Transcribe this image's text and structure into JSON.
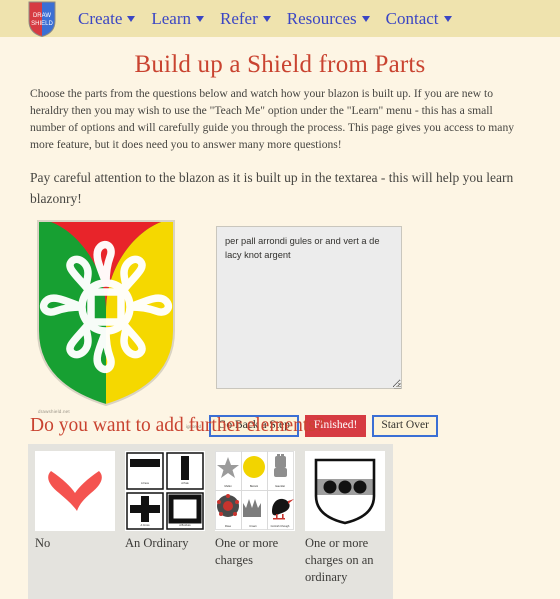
{
  "nav": {
    "logo": {
      "name": "drawshield-logo",
      "line1": "DRAW",
      "line2": "SHIELD",
      "left_color": "#d63b42",
      "right_color": "#3b6fd4"
    },
    "items": [
      {
        "label": "Create",
        "icon": "chevron-down-icon"
      },
      {
        "label": "Learn",
        "icon": "chevron-down-icon"
      },
      {
        "label": "Refer",
        "icon": "chevron-down-icon"
      },
      {
        "label": "Resources",
        "icon": "chevron-down-icon"
      },
      {
        "label": "Contact",
        "icon": "chevron-down-icon"
      }
    ],
    "link_color": "#3b46c4",
    "bar_color": "#efe3ae"
  },
  "page": {
    "title": "Build up a Shield from Parts",
    "title_color": "#c94330",
    "background_color": "#fdf5e4",
    "paragraph1": "Choose the parts from the questions below and watch how your blazon is built up. If you are new to heraldry then you may wish to use the \"Teach Me\" option under the \"Learn\" menu - this has a small number of options and will carefully guide you through the process. This page gives you access to many more feature, but it does need you to answer many more questions!",
    "paragraph2": "Pay careful attention to the blazon as it is built up in the textarea - this will help you learn blazonry!"
  },
  "shield_preview": {
    "name": "shield-preview",
    "watermark": "drawshield.net",
    "division": "per pall arrondi",
    "field_colors": {
      "dexter": "#17a032",
      "chief": "#e8242a",
      "sinister": "#f5d800"
    },
    "charge": "de lacy knot",
    "charge_color": "#f2f2f2"
  },
  "blazon": {
    "name": "blazon-textarea",
    "value": "per pall arrondi  gules or and vert   a de lacy knot  argent",
    "placeholder": ""
  },
  "buttons": {
    "tiny_label": "ignored",
    "items": [
      {
        "label": "Go Back a Step",
        "style": "normal"
      },
      {
        "label": "Finished!",
        "style": "danger"
      },
      {
        "label": "Start Over",
        "style": "normal"
      }
    ],
    "border_color": "#3b6fd4",
    "danger_color": "#d63b42"
  },
  "question": {
    "heading": "Do you want to add further elements?",
    "options": [
      {
        "label": "No",
        "thumb": "red-cross-x",
        "icon_color": "#f4534f"
      },
      {
        "label": "An Ordinary",
        "thumb": "ordinary-grid",
        "cells": [
          {
            "caption": "A Fess"
          },
          {
            "caption": "A Pale"
          },
          {
            "caption": "A Cross"
          },
          {
            "caption": "A Bordure"
          }
        ]
      },
      {
        "label": "One or more charges",
        "thumb": "charges-grid",
        "cells": [
          {
            "caption": "Mullet"
          },
          {
            "caption": "Bezant"
          },
          {
            "caption": "Gauntlet"
          },
          {
            "caption": "Rose"
          },
          {
            "caption": "Crown"
          },
          {
            "caption": "Cornish Chough"
          }
        ]
      },
      {
        "label": "One or more charges on an ordinary",
        "thumb": "shield-fess-roundels"
      }
    ]
  }
}
